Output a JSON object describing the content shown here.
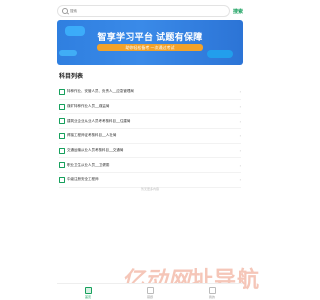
{
  "search": {
    "placeholder": "搜索",
    "button_label": "搜索"
  },
  "banner": {
    "title": "智享学习平台 试题有保障",
    "subtitle": "助你轻松备考 一次通过考试"
  },
  "section": {
    "title": "科目列表"
  },
  "subjects": [
    {
      "label": "特种作业、安管人员、负责人__应急管理局"
    },
    {
      "label": "煤矿特种作业人员__煤监局"
    },
    {
      "label": "建筑业企业从业人员考考核科目__住建局"
    },
    {
      "label": "焊接工程师证考核科目__人社局"
    },
    {
      "label": "交通运输从业人员考核科目__交通局"
    },
    {
      "label": "职业卫生从业人员__卫健委"
    },
    {
      "label": "中级注册安全工程师"
    }
  ],
  "list_footer": "暂无更多内容",
  "watermark": {
    "logo": "亿动网",
    "text": "址导航"
  },
  "tabs": [
    {
      "label": "首页",
      "icon": "home-icon",
      "active": true
    },
    {
      "label": "错题",
      "icon": "wrong-questions-icon",
      "active": false
    },
    {
      "label": "我的",
      "icon": "user-icon",
      "active": false
    }
  ],
  "colors": {
    "accent": "#17a05d",
    "banner_blue": "#2f7fe0",
    "banner_orange": "#f2a22a",
    "watermark": "#f5c6b8"
  }
}
